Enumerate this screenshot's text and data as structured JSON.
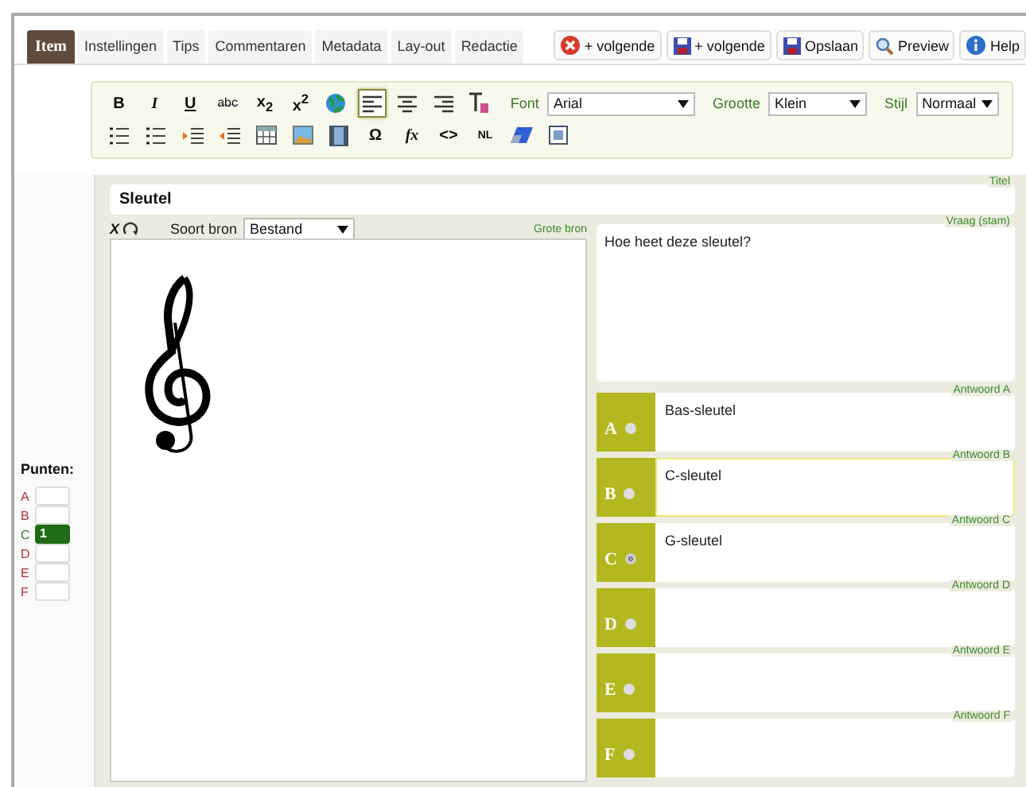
{
  "tabs": [
    {
      "label": "Item",
      "selected": true
    },
    {
      "label": "Instellingen",
      "selected": false
    },
    {
      "label": "Tips",
      "selected": false
    },
    {
      "label": "Commentaren",
      "selected": false
    },
    {
      "label": "Metadata",
      "selected": false
    },
    {
      "label": "Lay-out",
      "selected": false
    },
    {
      "label": "Redactie",
      "selected": false
    }
  ],
  "actions": [
    {
      "kind": "cancel",
      "label": "+ volgende"
    },
    {
      "kind": "save",
      "label": "+ volgende"
    },
    {
      "kind": "save",
      "label": "Opslaan"
    },
    {
      "kind": "preview",
      "label": "Preview"
    },
    {
      "kind": "help",
      "label": "Help"
    }
  ],
  "toolbar": {
    "row_1": [
      {
        "kind": "bold",
        "label": "B",
        "selected": false
      },
      {
        "kind": "italic",
        "label": "I",
        "selected": false
      },
      {
        "kind": "underline",
        "label": "U",
        "selected": false
      },
      {
        "kind": "strike",
        "label": "abc",
        "selected": false
      },
      {
        "kind": "text",
        "label": "x$_{2}$",
        "selected": false
      },
      {
        "kind": "text",
        "label": "x$^{2}$",
        "selected": false
      },
      {
        "kind": "globe",
        "selected": false
      },
      {
        "kind": "align-left",
        "selected": true
      },
      {
        "kind": "align-center",
        "selected": false
      },
      {
        "kind": "align-right",
        "selected": false
      },
      {
        "kind": "clear-format",
        "selected": false
      }
    ],
    "selects": [
      {
        "label": "Font",
        "value": "Arial"
      },
      {
        "label": "Grootte",
        "value": "Klein"
      },
      {
        "label": "Stijl",
        "value": "Normaal"
      }
    ],
    "row_2": [
      {
        "kind": "bullets",
        "selected": false
      },
      {
        "kind": "numbers",
        "selected": false
      },
      {
        "kind": "indent",
        "selected": false
      },
      {
        "kind": "outdent",
        "selected": false
      },
      {
        "kind": "table",
        "selected": false
      },
      {
        "kind": "image",
        "selected": false
      },
      {
        "kind": "film",
        "selected": false
      },
      {
        "kind": "text",
        "label": "Ω",
        "selected": false
      },
      {
        "kind": "italic",
        "label": "fx",
        "selected": false
      },
      {
        "kind": "bold",
        "label": "<>",
        "selected": false
      },
      {
        "kind": "small",
        "label": "NL",
        "selected": false
      },
      {
        "kind": "eraser",
        "selected": false
      },
      {
        "kind": "fullscreen",
        "selected": false
      }
    ]
  },
  "punten": {
    "heading": "Punten:",
    "rows": [
      {
        "letter": "A",
        "correct": false
      },
      {
        "letter": "B",
        "correct": false
      },
      {
        "letter": "C",
        "value": "1",
        "correct": true
      },
      {
        "letter": "D",
        "correct": false
      },
      {
        "letter": "E",
        "correct": false
      },
      {
        "letter": "F",
        "correct": false
      }
    ]
  },
  "title": {
    "caption": "Titel",
    "value": "Sleutel"
  },
  "source": {
    "delete": "X",
    "type_label": "Soort bron",
    "type_value": "Bestand",
    "caption": "Grote bron"
  },
  "question": {
    "caption": "Vraag (stam)",
    "value": "Hoe heet deze sleutel?"
  },
  "answers": [
    {
      "letter": "A",
      "caption": "Antwoord A",
      "value": "Bas-sleutel",
      "selected": false,
      "focused": false
    },
    {
      "letter": "B",
      "caption": "Antwoord B",
      "value": "C-sleutel",
      "selected": false,
      "focused": true
    },
    {
      "letter": "C",
      "caption": "Antwoord C",
      "value": "G-sleutel",
      "selected": true,
      "focused": false
    },
    {
      "letter": "D",
      "caption": "Antwoord D",
      "selected": false,
      "focused": false
    },
    {
      "letter": "E",
      "caption": "Antwoord E",
      "selected": false,
      "focused": false
    },
    {
      "letter": "F",
      "caption": "Antwoord F",
      "selected": false,
      "focused": false
    }
  ]
}
